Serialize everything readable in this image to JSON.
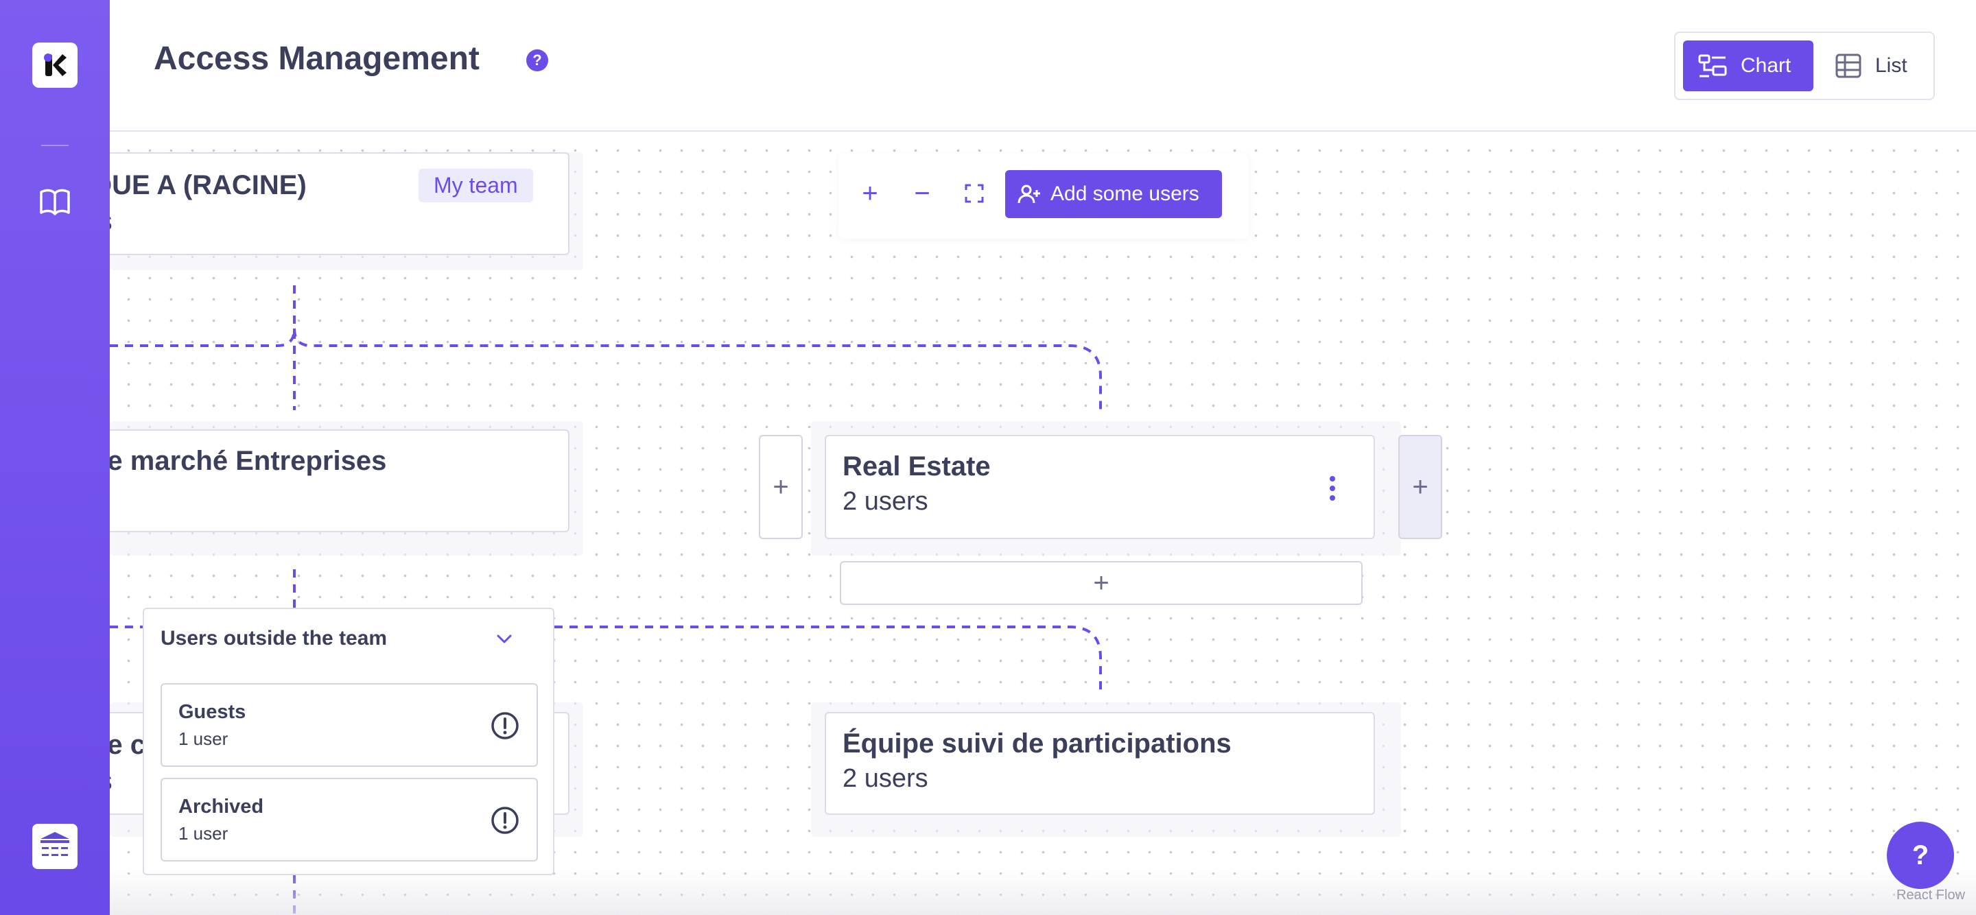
{
  "app": {
    "title": "Access Management",
    "help_glyph": "?"
  },
  "view_toggle": {
    "chart_label": "Chart",
    "list_label": "List",
    "active": "Chart"
  },
  "toolbar": {
    "zoom_in": "+",
    "zoom_out": "−",
    "add_users_label": "Add some users"
  },
  "nodes": {
    "root": {
      "title": "QUE A (RACINE)",
      "sub": "rs",
      "badge": "My team"
    },
    "enterprises": {
      "title": "pe marché Entreprises"
    },
    "real_estate": {
      "title": "Real Estate",
      "sub": "2 users"
    },
    "left_bottom": {
      "title": "pe c",
      "sub": "rs"
    },
    "participations": {
      "title": "Équipe suivi de participations",
      "sub": "2 users"
    }
  },
  "plus_glyph": "+",
  "outside_panel": {
    "title": "Users outside the team",
    "items": [
      {
        "label": "Guests",
        "count": "1 user"
      },
      {
        "label": "Archived",
        "count": "1 user"
      }
    ]
  },
  "help_fab": "?",
  "attribution": "React Flow",
  "colors": {
    "accent": "#6c4ce8",
    "sidebar": "#7d5cf0",
    "text": "#3b3f5c"
  }
}
